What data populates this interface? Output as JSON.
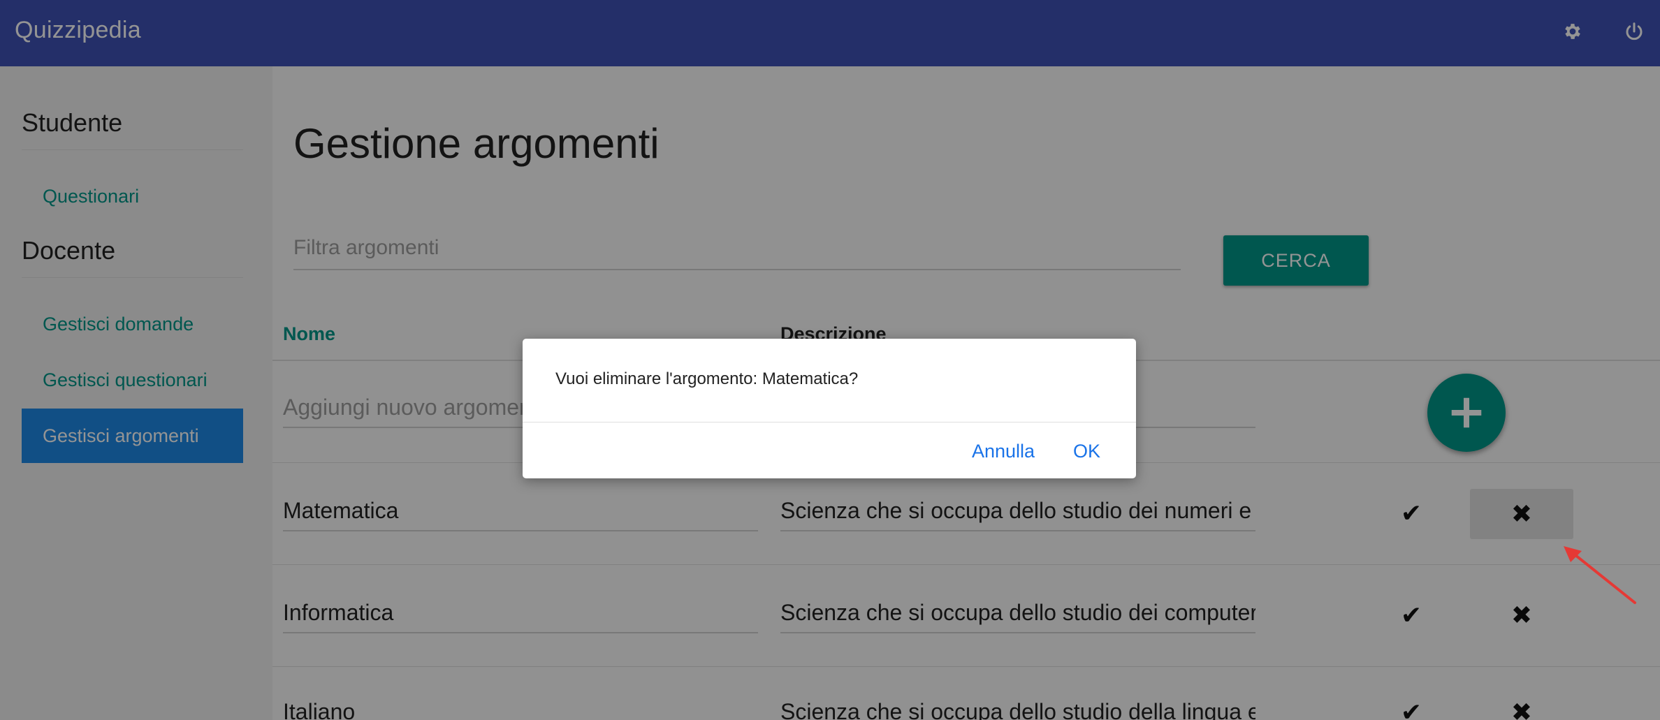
{
  "app": {
    "title": "Quizzipedia"
  },
  "topbar": {
    "settings_icon": "gear-icon",
    "logout_icon": "power-icon"
  },
  "sidebar": {
    "sections": [
      {
        "title": "Studente",
        "items": [
          {
            "label": "Questionari",
            "active": false
          }
        ]
      },
      {
        "title": "Docente",
        "items": [
          {
            "label": "Gestisci domande",
            "active": false
          },
          {
            "label": "Gestisci questionari",
            "active": false
          },
          {
            "label": "Gestisci argomenti",
            "active": true
          }
        ]
      }
    ]
  },
  "main": {
    "title": "Gestione argomenti",
    "filter": {
      "placeholder": "Filtra argomenti",
      "value": ""
    },
    "search_label": "CERCA",
    "columns": {
      "name": "Nome",
      "description": "Descrizione"
    },
    "new_row": {
      "name_placeholder": "Aggiungi nuovo argomento",
      "desc_placeholder": ""
    },
    "rows": [
      {
        "name": "Matematica",
        "description": "Scienza che si occupa dello studio dei numeri e d"
      },
      {
        "name": "Informatica",
        "description": "Scienza che si occupa dello studio dei computer"
      },
      {
        "name": "Italiano",
        "description": "Scienza che si occupa dello studio della lingua e c"
      }
    ]
  },
  "dialog": {
    "message": "Vuoi eliminare l'argomento: Matematica?",
    "cancel_label": "Annulla",
    "ok_label": "OK"
  },
  "colors": {
    "primary": "#3f51b5",
    "accent": "#009688",
    "active_nav": "#1e88e5",
    "annotation": "#e53935"
  }
}
